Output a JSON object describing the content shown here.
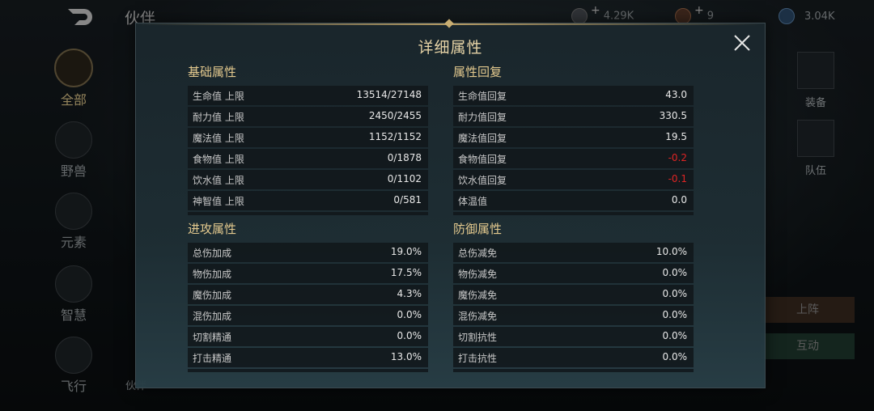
{
  "header": {
    "title": "伙伴",
    "resources": [
      {
        "value": "4.29K",
        "has_plus": true
      },
      {
        "value": "9",
        "has_plus": true
      },
      {
        "value": "3.04K",
        "has_plus": false
      }
    ]
  },
  "sidebar": {
    "items": [
      {
        "label": "全部",
        "active": true
      },
      {
        "label": "野兽",
        "active": false
      },
      {
        "label": "元素",
        "active": false
      },
      {
        "label": "智慧",
        "active": false
      },
      {
        "label": "飞行",
        "active": false
      }
    ]
  },
  "right_panel": {
    "icons": [
      {
        "label": "装备"
      },
      {
        "label": "队伍"
      }
    ],
    "buttons": {
      "deploy": "上阵",
      "interact": "互动"
    }
  },
  "bottom_name": "伙伴",
  "modal": {
    "title": "详细属性",
    "sections": {
      "base": {
        "title": "基础属性",
        "rows": [
          {
            "k": "生命值 上限",
            "v": "13514/27148"
          },
          {
            "k": "耐力值 上限",
            "v": "2450/2455"
          },
          {
            "k": "魔法值 上限",
            "v": "1152/1152"
          },
          {
            "k": "食物值 上限",
            "v": "0/1878"
          },
          {
            "k": "饮水值 上限",
            "v": "0/1102"
          },
          {
            "k": "神智值 上限",
            "v": "0/581"
          }
        ]
      },
      "regen": {
        "title": "属性回复",
        "rows": [
          {
            "k": "生命值回复",
            "v": "43.0"
          },
          {
            "k": "耐力值回复",
            "v": "330.5"
          },
          {
            "k": "魔法值回复",
            "v": "19.5"
          },
          {
            "k": "食物值回复",
            "v": "-0.2",
            "neg": true
          },
          {
            "k": "饮水值回复",
            "v": "-0.1",
            "neg": true
          },
          {
            "k": "体温值",
            "v": "0.0"
          }
        ]
      },
      "attack": {
        "title": "进攻属性",
        "rows": [
          {
            "k": "总伤加成",
            "v": "19.0%"
          },
          {
            "k": "物伤加成",
            "v": "17.5%"
          },
          {
            "k": "魔伤加成",
            "v": "4.3%"
          },
          {
            "k": "混伤加成",
            "v": "0.0%"
          },
          {
            "k": "切割精通",
            "v": "0.0%"
          },
          {
            "k": "打击精通",
            "v": "13.0%"
          }
        ]
      },
      "defense": {
        "title": "防御属性",
        "rows": [
          {
            "k": "总伤减免",
            "v": "10.0%"
          },
          {
            "k": "物伤减免",
            "v": "0.0%"
          },
          {
            "k": "魔伤减免",
            "v": "0.0%"
          },
          {
            "k": "混伤减免",
            "v": "0.0%"
          },
          {
            "k": "切割抗性",
            "v": "0.0%"
          },
          {
            "k": "打击抗性",
            "v": "0.0%"
          }
        ]
      }
    }
  },
  "colors": {
    "gold": "#e3c98e",
    "negative": "#e02424",
    "panel": "#1e2e34"
  }
}
